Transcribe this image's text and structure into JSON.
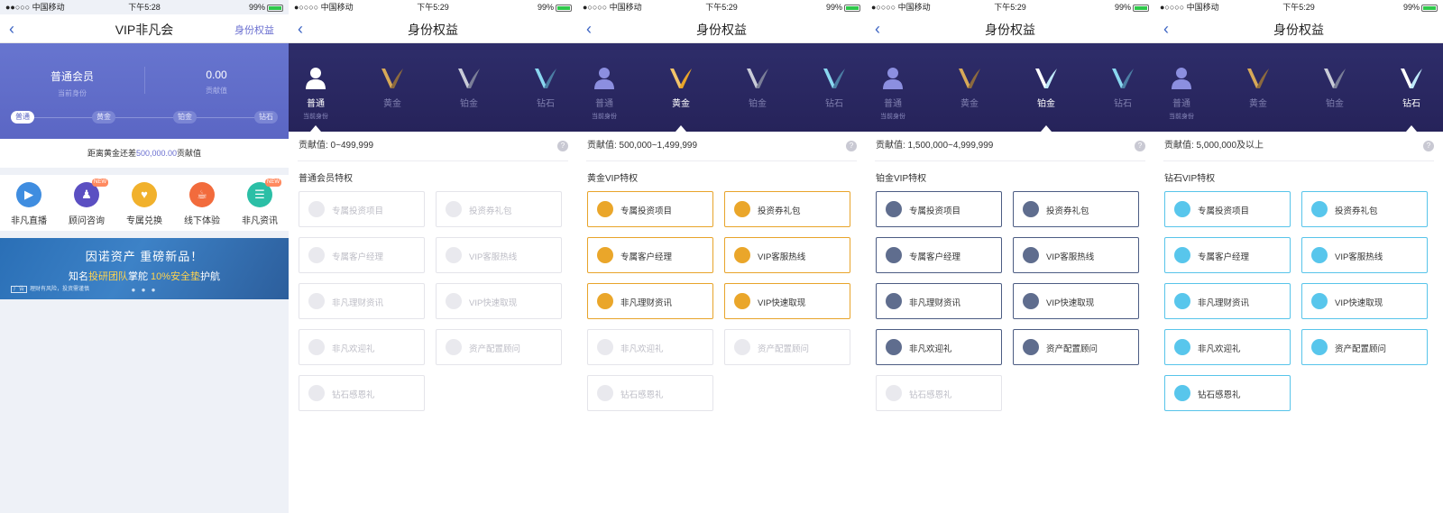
{
  "colors": {
    "brand_purple": "#5b66c4",
    "gold": "#e8a42a",
    "platinum": "#4c5c83",
    "diamond": "#57c4ea",
    "tier_strip_bg": "#2b2a65"
  },
  "screens": [
    {
      "status": {
        "carrier": "●●○○○ 中国移动",
        "time": "下午5:28",
        "battery": "99%"
      },
      "navbar": {
        "title": "VIP非凡会",
        "right": "身份权益"
      },
      "member": {
        "level_value": "普通会员",
        "level_label": "当前身份",
        "points_value": "0.00",
        "points_label": "贡献值",
        "tiers": [
          "普通",
          "黄金",
          "铂金",
          "钻石"
        ]
      },
      "gap": {
        "prefix": "距离黄金还差",
        "amount": "500,000.00",
        "suffix": "贡献值"
      },
      "quick": [
        {
          "label": "非凡直播",
          "icon": "video-icon",
          "color": "#3f8de0",
          "badge": ""
        },
        {
          "label": "顾问咨询",
          "icon": "advisor-icon",
          "color": "#5b4fc2",
          "badge": "NEW"
        },
        {
          "label": "专属兑换",
          "icon": "gift-bag-icon",
          "color": "#f1b12c",
          "badge": ""
        },
        {
          "label": "线下体验",
          "icon": "cup-icon",
          "color": "#f26b3c",
          "badge": ""
        },
        {
          "label": "非凡资讯",
          "icon": "news-icon",
          "color": "#2bbfa6",
          "badge": "NEW"
        }
      ],
      "banner": {
        "line1": "因诺资产  重磅新品！",
        "line2_a": "知名",
        "line2_b": "投研团队",
        "line2_c": "掌舵  ",
        "line2_d": "10%安全垫",
        "line2_e": "护航",
        "ad_tag": "广告",
        "disclaimer": "理财有风险，投资需谨慎"
      }
    }
  ],
  "benefits": {
    "nav_title": "身份权益",
    "tier_names": [
      "普通",
      "黄金",
      "铂金",
      "钻石"
    ],
    "current_label": "当前身份",
    "items": [
      "专属投资项目",
      "投资券礼包",
      "专属客户经理",
      "VIP客服热线",
      "非凡理财资讯",
      "VIP快速取现",
      "非凡欢迎礼",
      "资产配置顾问",
      "钻石感恩礼"
    ],
    "pages": [
      {
        "time": "下午5:29",
        "contrib": "贡献值: 0~499,999",
        "section": "普通会员特权"
      },
      {
        "time": "下午5:29",
        "contrib": "贡献值: 500,000~1,499,999",
        "section": "黄金VIP特权"
      },
      {
        "time": "下午5:29",
        "contrib": "贡献值: 1,500,000~4,999,999",
        "section": "铂金VIP特权"
      },
      {
        "time": "下午5:29",
        "contrib": "贡献值: 5,000,000及以上",
        "section": "钻石VIP特权"
      }
    ],
    "carrier": "●○○○○ 中国移动",
    "battery": "99%"
  }
}
